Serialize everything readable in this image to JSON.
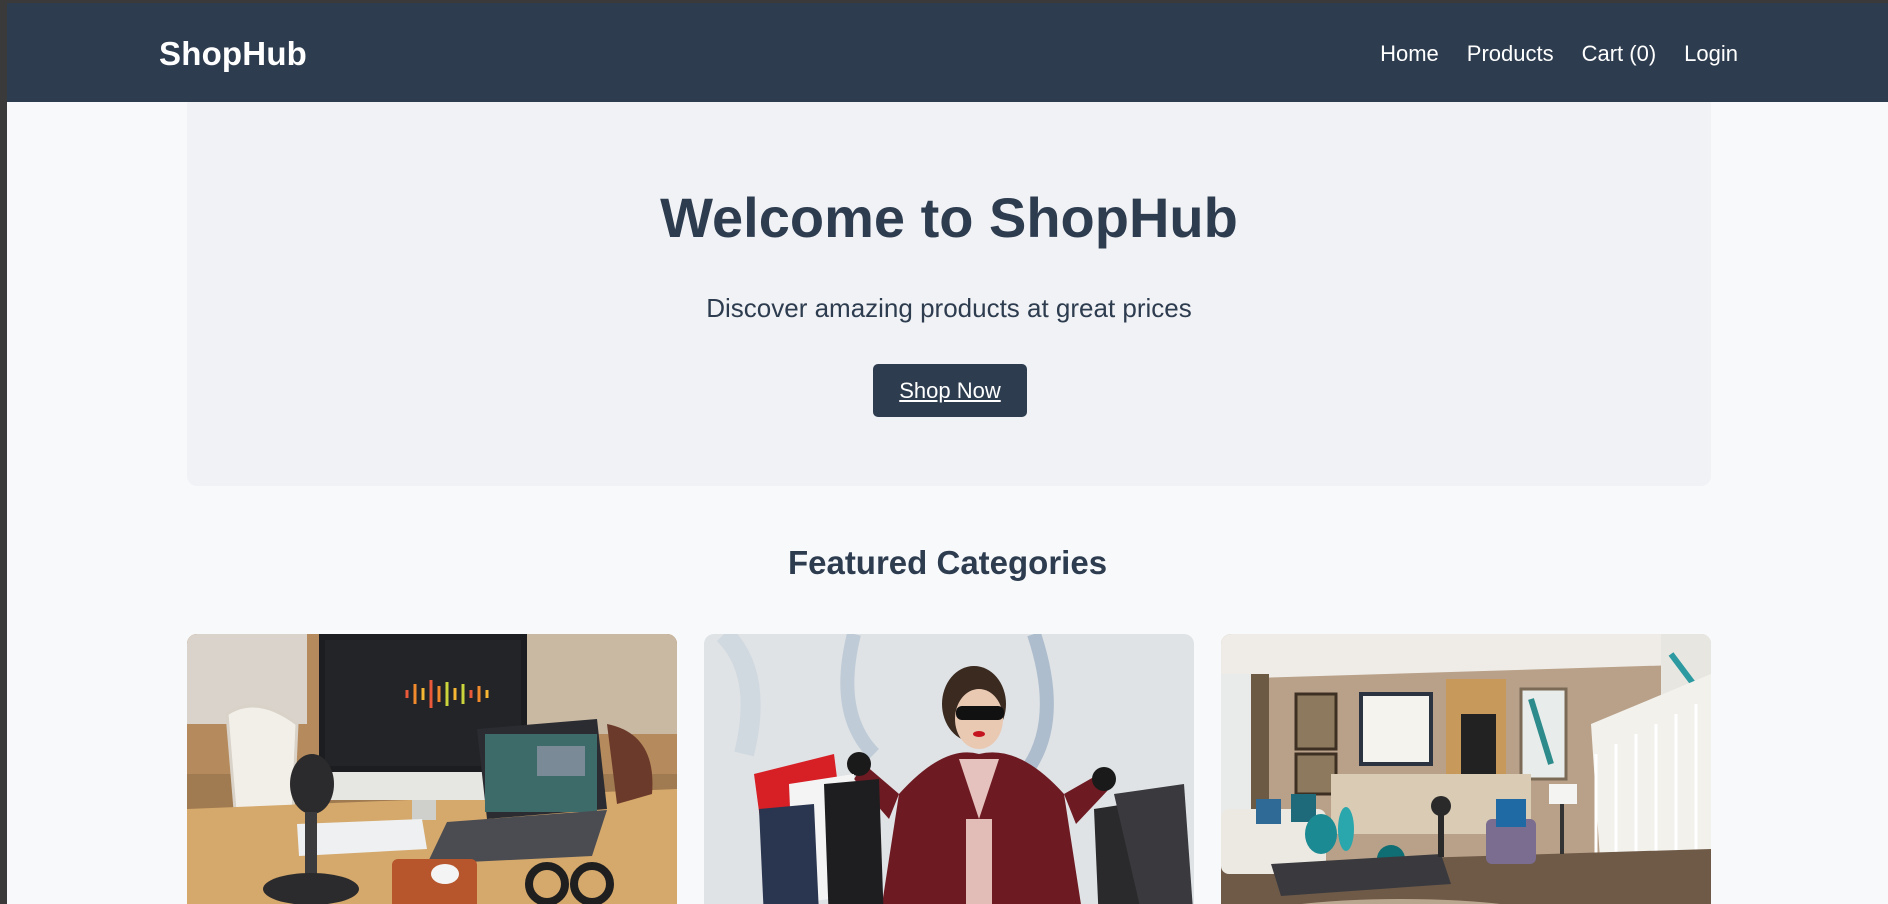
{
  "nav": {
    "brand": "ShopHub",
    "links": [
      "Home",
      "Products",
      "Cart (0)",
      "Login"
    ]
  },
  "hero": {
    "title": "Welcome to ShopHub",
    "subtitle": "Discover amazing products at great prices",
    "cta_label": "Shop Now"
  },
  "featured": {
    "title": "Featured Categories"
  },
  "colors": {
    "navbar": "#2d3c4f",
    "hero_bg": "#f1f2f5",
    "page_bg": "#f8f9fb",
    "text_dark": "#2d3c4f"
  }
}
